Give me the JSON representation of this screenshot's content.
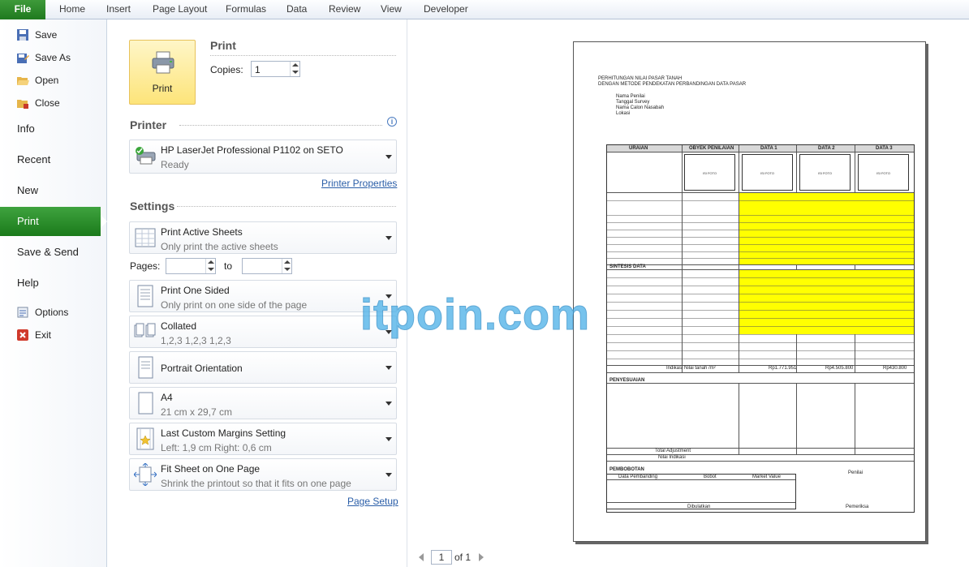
{
  "ribbon": {
    "file": "File",
    "tabs": [
      "Home",
      "Insert",
      "Page Layout",
      "Formulas",
      "Data",
      "Review",
      "View",
      "Developer"
    ]
  },
  "nav": {
    "save": "Save",
    "save_as": "Save As",
    "open": "Open",
    "close": "Close",
    "info": "Info",
    "recent": "Recent",
    "new": "New",
    "print": "Print",
    "save_send": "Save & Send",
    "help": "Help",
    "options": "Options",
    "exit": "Exit"
  },
  "print": {
    "header": "Print",
    "button_label": "Print",
    "copies_label": "Copies:",
    "copies_value": "1"
  },
  "printer": {
    "header": "Printer",
    "name": "HP LaserJet Professional P1102 on SETO",
    "status": "Ready",
    "properties_link": "Printer Properties"
  },
  "settings": {
    "header": "Settings",
    "active_sheets": {
      "title": "Print Active Sheets",
      "desc": "Only print the active sheets"
    },
    "pages_label": "Pages:",
    "to_label": "to",
    "one_sided": {
      "title": "Print One Sided",
      "desc": "Only print on one side of the page"
    },
    "collated": {
      "title": "Collated",
      "desc": "1,2,3    1,2,3    1,2,3"
    },
    "orientation": {
      "title": "Portrait Orientation"
    },
    "paper": {
      "title": "A4",
      "desc": "21 cm x 29,7 cm"
    },
    "margins": {
      "title": "Last Custom Margins Setting",
      "desc": "Left:  1,9 cm    Right:  0,6 cm"
    },
    "scaling": {
      "title": "Fit Sheet on One Page",
      "desc": "Shrink the printout so that it fits on one page"
    },
    "page_setup_link": "Page Setup"
  },
  "preview": {
    "page_value": "1",
    "of_label": "of 1",
    "sheet": {
      "title1": "PERHITUNGAN NILAI PASAR TANAH",
      "title2": "DENGAN METODE PENDEKATAN PERBANDINGAN DATA PASAR",
      "meta": [
        "Nama Penilai",
        "Tanggal Survey",
        "Nama Calon Nasabah",
        "Lokasi"
      ],
      "headers": [
        "URAIAN",
        "OBYEK PENILAIAN",
        "DATA 1",
        "DATA 2",
        "DATA 3"
      ],
      "photo": "ISI FOTO",
      "indikasi_label": "Indikasi Nilai tanah /m²",
      "indikasi_values": [
        "Rp1.771.951",
        "Rp4.505.800",
        "Rp430.800"
      ],
      "sintesis": "SINTESIS DATA",
      "penyesuaian": "PENYESUAIAN",
      "total_adjustment": "Total Adjustment",
      "nilai_indikasi": "Nilai Indikasi",
      "pembobotan": "PEMBOBOTAN",
      "data_pembanding": "Data Pembanding",
      "bobot": "Bobot",
      "market_value": "Market Value",
      "penilai": "Penilai",
      "dibulatkan": "Dibulatkan",
      "pemeriksa": "Pemeriksa"
    }
  },
  "watermark": "itpoin.com",
  "colors": {
    "file_tab": "#2a8a2a",
    "active_nav": "#2e8f2e",
    "highlight": "#ffff00",
    "link": "#2a5ea8"
  }
}
